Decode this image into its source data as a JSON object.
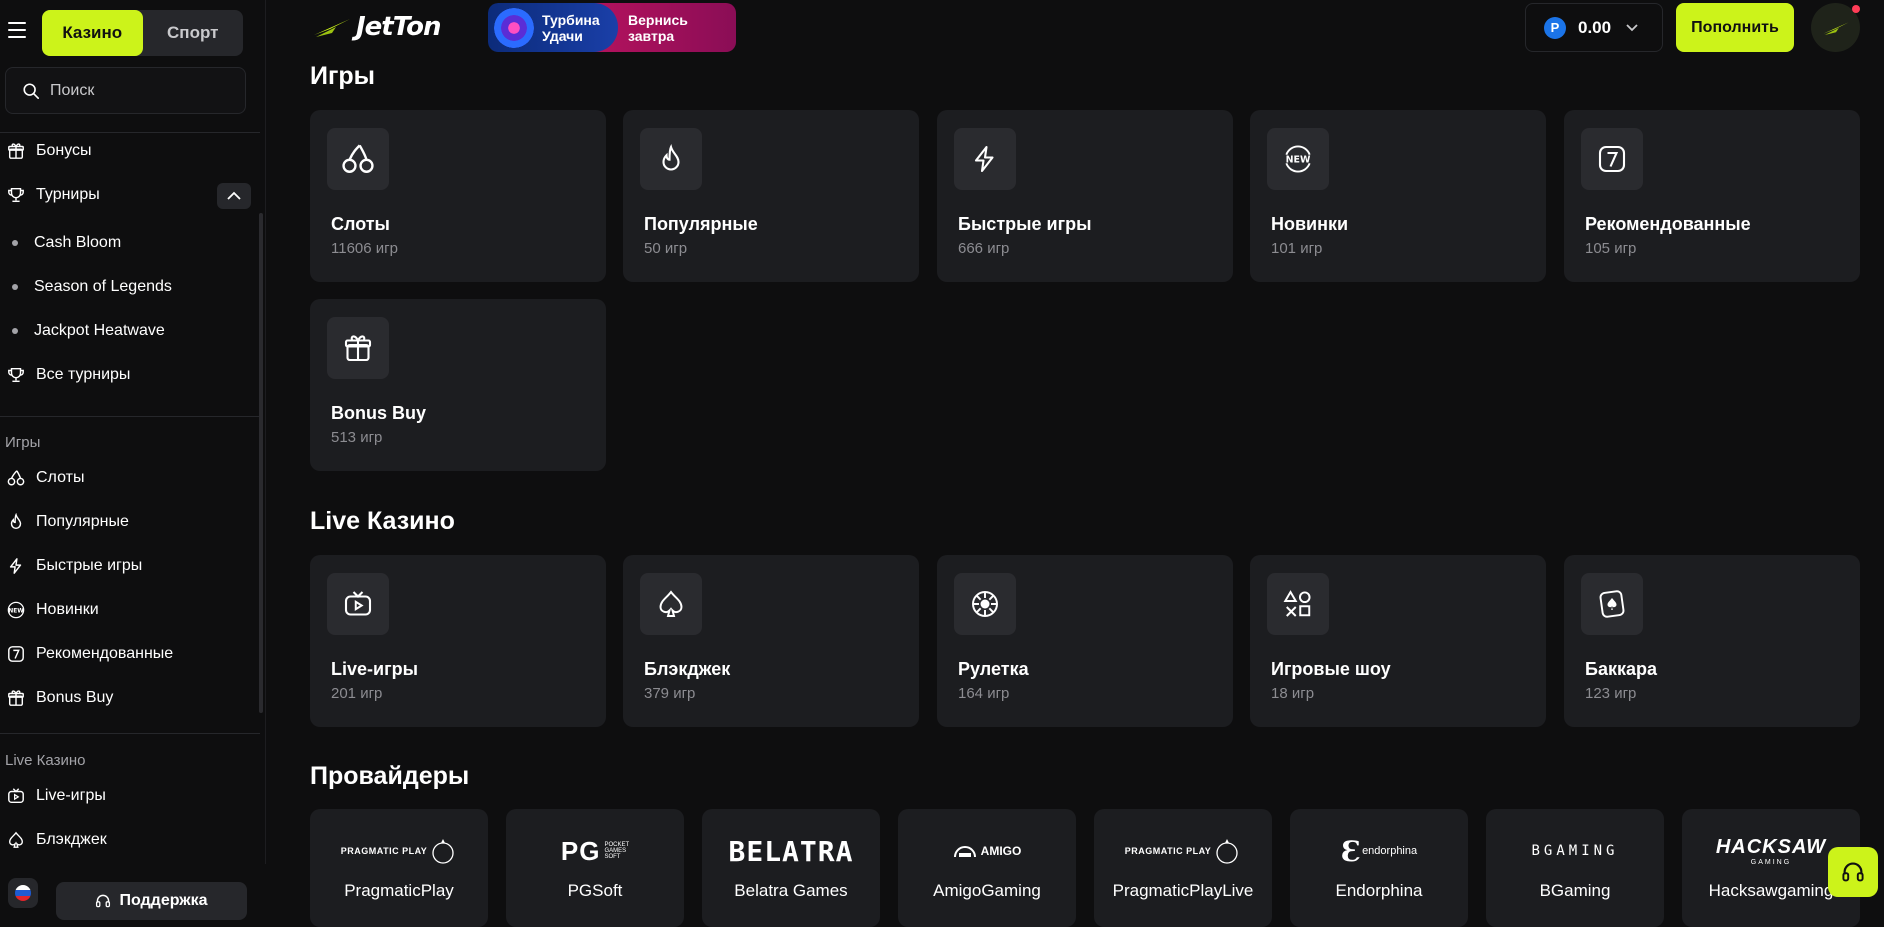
{
  "header": {
    "logo_text": "JetTon",
    "promo": {
      "left_line1": "Турбина",
      "left_line2": "Удачи",
      "right_line1": "Вернись",
      "right_line2": "завтра"
    },
    "balance": {
      "currency_symbol": "Р",
      "amount": "0.00"
    },
    "deposit_label": "Пополнить",
    "colors": {
      "accent": "#ccf31a",
      "background": "#0e0e0f",
      "card": "#1c1d20"
    }
  },
  "sidebar": {
    "modes": [
      "Казино",
      "Спорт"
    ],
    "search_placeholder": "Поиск",
    "top_items": [
      {
        "label": "Бонусы",
        "icon": "gift-icon"
      },
      {
        "label": "Турниры",
        "icon": "trophy-icon"
      }
    ],
    "tournaments": [
      "Cash Bloom",
      "Season of Legends",
      "Jackpot Heatwave"
    ],
    "all_tournaments": "Все турниры",
    "games_label": "Игры",
    "games_items": [
      "Слоты",
      "Популярные",
      "Быстрые игры",
      "Новинки",
      "Рекомендованные",
      "Bonus Buy"
    ],
    "live_label": "Live Казино",
    "live_items": [
      "Live-игры",
      "Блэкджек"
    ],
    "support_label": "Поддержка"
  },
  "games": {
    "heading": "Игры",
    "cards": [
      {
        "title": "Слоты",
        "count": "11606 игр",
        "icon": "cherries-icon"
      },
      {
        "title": "Популярные",
        "count": "50 игр",
        "icon": "flame-icon"
      },
      {
        "title": "Быстрые игры",
        "count": "666 игр",
        "icon": "lightning-icon"
      },
      {
        "title": "Новинки",
        "count": "101 игр",
        "icon": "new-badge-icon"
      },
      {
        "title": "Рекомендованные",
        "count": "105 игр",
        "icon": "seven-icon"
      },
      {
        "title": "Bonus Buy",
        "count": "513 игр",
        "icon": "gift-icon"
      }
    ]
  },
  "live": {
    "heading": "Live Казино",
    "cards": [
      {
        "title": "Live-игры",
        "count": "201 игр",
        "icon": "tv-icon"
      },
      {
        "title": "Блэкджек",
        "count": "379 игр",
        "icon": "spade-icon"
      },
      {
        "title": "Рулетка",
        "count": "164 игр",
        "icon": "roulette-icon"
      },
      {
        "title": "Игровые шоу",
        "count": "18 игр",
        "icon": "gamepad-shapes-icon"
      },
      {
        "title": "Баккара",
        "count": "123 игр",
        "icon": "card-icon"
      }
    ]
  },
  "providers": {
    "heading": "Провайдеры",
    "items": [
      {
        "name": "PragmaticPlay",
        "logo": "PRAGMATIC PLAY"
      },
      {
        "name": "PGSoft",
        "logo": "PG"
      },
      {
        "name": "Belatra Games",
        "logo": "BELATRA"
      },
      {
        "name": "AmigoGaming",
        "logo": "AMIGO"
      },
      {
        "name": "PragmaticPlayLive",
        "logo": "PRAGMATIC PLAY"
      },
      {
        "name": "Endorphina",
        "logo": "endorphina"
      },
      {
        "name": "BGaming",
        "logo": "BGAMING"
      },
      {
        "name": "Hacksawgaming",
        "logo": "HACKSAW"
      }
    ]
  }
}
